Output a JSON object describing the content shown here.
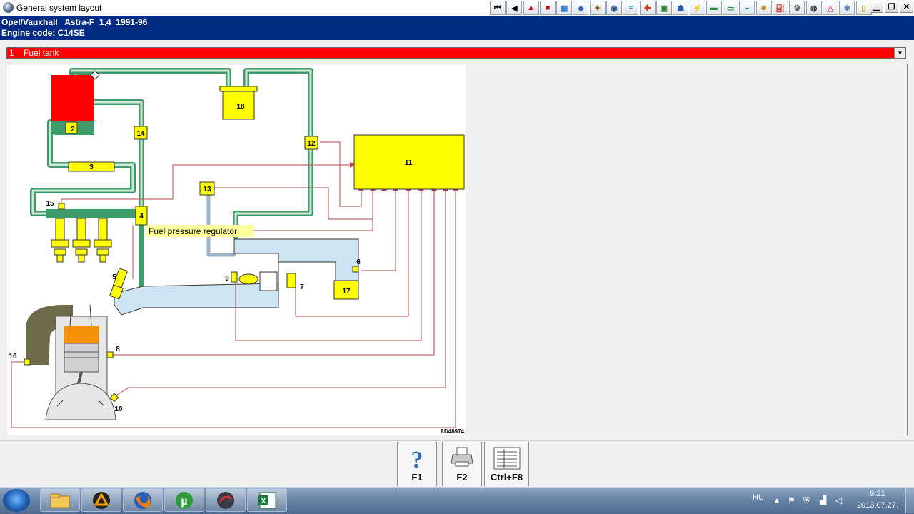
{
  "window": {
    "title": "General system layout",
    "toolbar_icons": [
      "first-page-icon",
      "previous-icon",
      "warning-icon",
      "flag-icon",
      "picture-icon",
      "manual-icon",
      "tools-icon",
      "gauge-icon",
      "thermometer-icon",
      "tools-2-icon",
      "mechanic-icon",
      "settings-icon",
      "electrics-icon",
      "oil-icon",
      "battery-icon",
      "car-icon",
      "filter-icon",
      "smiley-icon",
      "inspection-icon",
      "wheel-icon",
      "a-c-icon",
      "warning-2-icon",
      "note-icon"
    ],
    "controls": {
      "minimize": "▁",
      "maximize": "❐",
      "close": "✕"
    }
  },
  "vehicle": {
    "line1": "Opel/Vauxhall   Astra-F  1,4  1991-96",
    "line2": "Engine code: C14SE"
  },
  "component_select": {
    "value": "1    Fuel tank"
  },
  "diagram": {
    "tooltip": "Fuel pressure regulator",
    "reference": "AD48974",
    "labels": {
      "c2": "2",
      "c3": "3",
      "c4": "4",
      "c5": "5",
      "c6": "6",
      "c7": "7",
      "c8": "8",
      "c9": "9",
      "c10": "10",
      "c11": "11",
      "c12": "12",
      "c13": "13",
      "c14": "14",
      "c15": "15",
      "c16": "16",
      "c17": "17",
      "c18": "18"
    },
    "colors": {
      "fuel_line": "#3f9b6a",
      "fuel_line_fill": "#cfe9d5",
      "air_duct": "#cfe4f2",
      "component": "#ffff00",
      "tank": "#ff0000",
      "wiring": "#b8474f",
      "piston": "#f5900a",
      "intake": "#6d6b4c"
    }
  },
  "function_keys": [
    {
      "label": "F1",
      "icon": "help-icon"
    },
    {
      "label": "F2",
      "icon": "printer-icon"
    },
    {
      "label": "Ctrl+F8",
      "icon": "list-icon"
    }
  ],
  "taskbar": {
    "apps": [
      "explorer-icon",
      "autodata-icon",
      "firefox-icon",
      "utorrent-icon",
      "media-icon",
      "excel-icon"
    ],
    "language": "HU",
    "time": "9:21",
    "date": "2013.07.27."
  }
}
